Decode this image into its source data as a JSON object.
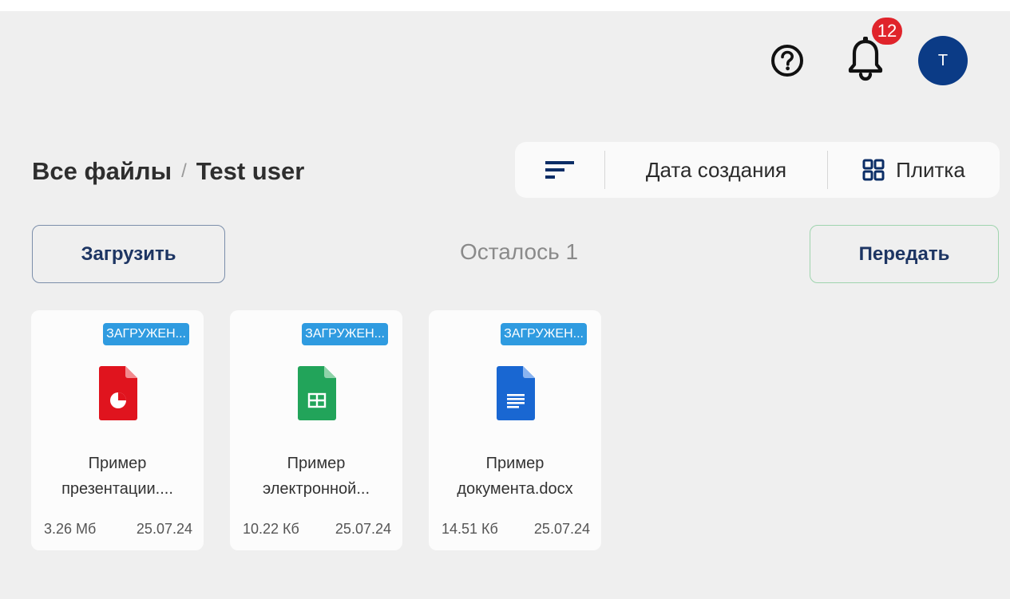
{
  "header": {
    "help_icon": "question-circle-icon",
    "notifications_icon": "bell-icon",
    "notification_count": "12",
    "avatar_initial": "T"
  },
  "breadcrumb": {
    "root": "Все файлы",
    "separator": "/",
    "current": "Test user"
  },
  "toolbar": {
    "sort_icon": "sort-lines-icon",
    "sort_field": "Дата создания",
    "view_icon": "grid-icon",
    "view_mode": "Плитка"
  },
  "actions": {
    "upload_label": "Загрузить",
    "remaining_text": "Осталось 1",
    "transfer_label": "Передать"
  },
  "colors": {
    "presentation": "#e0141e",
    "spreadsheet": "#22a45a",
    "document": "#1967d2",
    "status_badge": "#2f9be0",
    "avatar": "#0b3b86",
    "badge": "#e0242b"
  },
  "files": [
    {
      "status": "ЗАГРУЖЕН...",
      "type_icon": "presentation-file-icon",
      "name": "Пример презентации....",
      "size": "3.26 Мб",
      "date": "25.07.24"
    },
    {
      "status": "ЗАГРУЖЕН...",
      "type_icon": "spreadsheet-file-icon",
      "name": "Пример электронной...",
      "size": "10.22 Кб",
      "date": "25.07.24"
    },
    {
      "status": "ЗАГРУЖЕН...",
      "type_icon": "document-file-icon",
      "name": "Пример документа.docx",
      "size": "14.51 Кб",
      "date": "25.07.24"
    }
  ]
}
